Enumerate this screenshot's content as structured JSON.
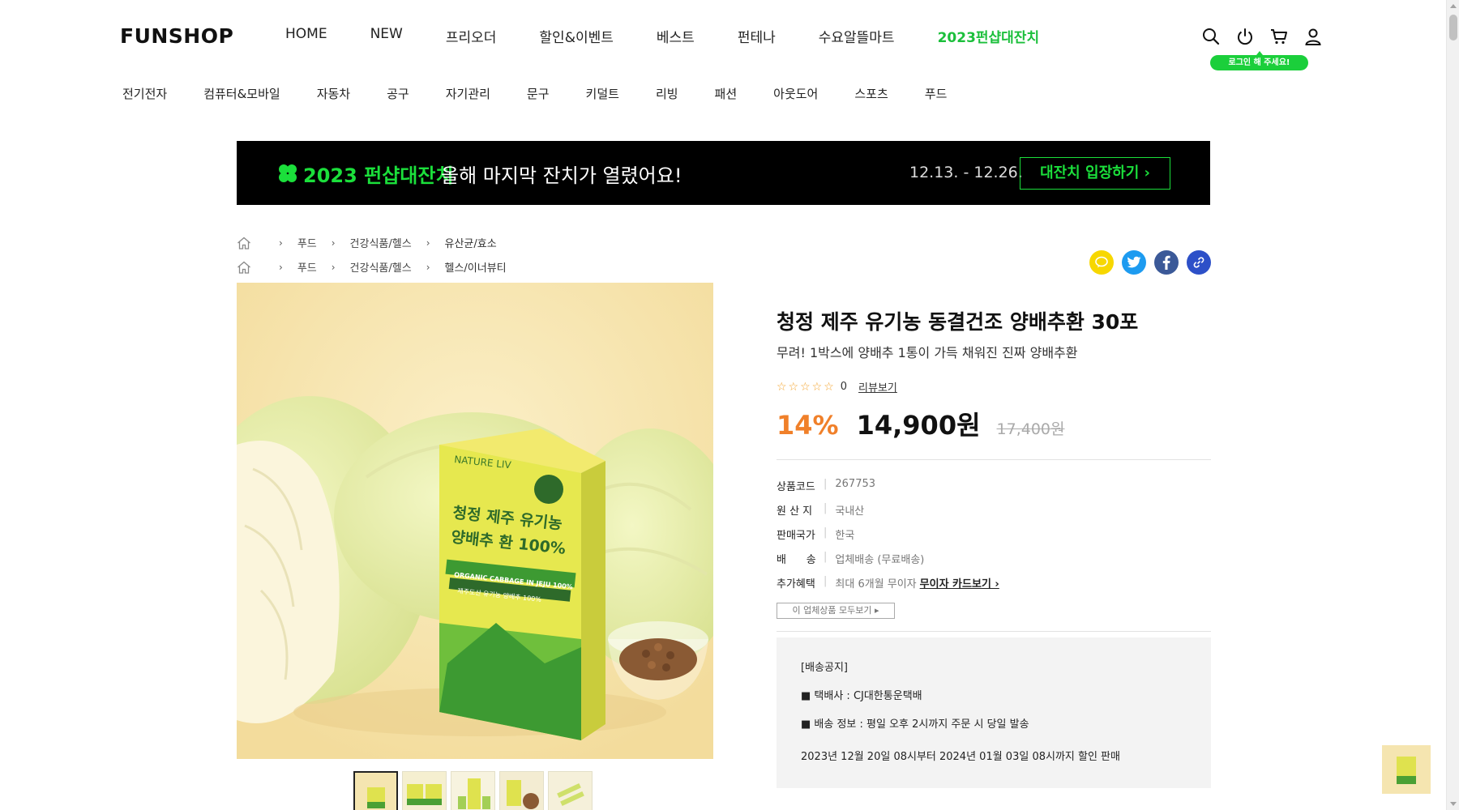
{
  "header": {
    "logo": "FUNSHOP",
    "nav": [
      "HOME",
      "NEW",
      "프리오더",
      "할인&이벤트",
      "베스트",
      "펀테나",
      "수요알뜰마트",
      "2023펀샵대잔치"
    ],
    "login_badge": "로그인 해 주세요!",
    "icons": [
      "search-icon",
      "power-icon",
      "cart-icon",
      "user-icon"
    ]
  },
  "categories": [
    "전기전자",
    "컴퓨터&모바일",
    "자동차",
    "공구",
    "자기관리",
    "문구",
    "키덜트",
    "리빙",
    "패션",
    "아웃도어",
    "스포츠",
    "푸드"
  ],
  "banner": {
    "title": "2023 펀샵대잔치",
    "subtitle": "올해 마지막 잔치가 열렸어요!",
    "date": "12.13. - 12.26.",
    "button": "대잔치 입장하기 ›",
    "accent": "#1bdf3b"
  },
  "breadcrumbs": [
    [
      "푸드",
      "건강식품/헬스",
      "유산균/효소"
    ],
    [
      "푸드",
      "건강식품/헬스",
      "헬스/이너뷰티"
    ]
  ],
  "share": {
    "icons": [
      "kakao-icon",
      "twitter-icon",
      "facebook-icon",
      "link-icon"
    ],
    "colors": [
      "#f7d700",
      "#1d9bf0",
      "#3b5998",
      "#2d50c8"
    ]
  },
  "product": {
    "title": "청정 제주 유기농 동결건조 양배추환 30포",
    "subtitle": "무려! 1박스에 양배추 1통이 가득 채워진 진짜 양배추환",
    "rating": {
      "stars": "☆☆☆☆☆",
      "count": "0",
      "review_link": "리뷰보기"
    },
    "discount_rate": "14%",
    "price": "14,900원",
    "original_price": "17,400원",
    "specs": [
      {
        "key": "상품코드",
        "value": "267753"
      },
      {
        "key": "원 산 지",
        "value": "국내산"
      },
      {
        "key": "판매국가",
        "value": "한국"
      },
      {
        "key": "배      송",
        "value": "업체배송 (무료배송)"
      },
      {
        "key": "추가혜택",
        "value": "최대 6개월 무이자",
        "link": "무이자 카드보기 ›"
      }
    ],
    "all_products_button": "이 업체상품 모두보기 ▸",
    "package": {
      "brand": "NATURE LIV",
      "line1": "청정 제주 유기농",
      "line2": "양배추 환 100%",
      "strip1": "ORGANIC CABBAGE IN JEJU 100%",
      "strip2": "제주도산 유기농 양배추 100%"
    }
  },
  "notice": {
    "title": "[배송공지]",
    "lines": [
      "■ 택배사 : CJ대한통운택배",
      "■ 배송 정보 : 평일 오후 2시까지 주문 시 당일 발송"
    ],
    "period": "2023년 12월 20일 08시부터 2024년 01월 03일 08시까지 할인 판매"
  },
  "thumbnails": 5
}
